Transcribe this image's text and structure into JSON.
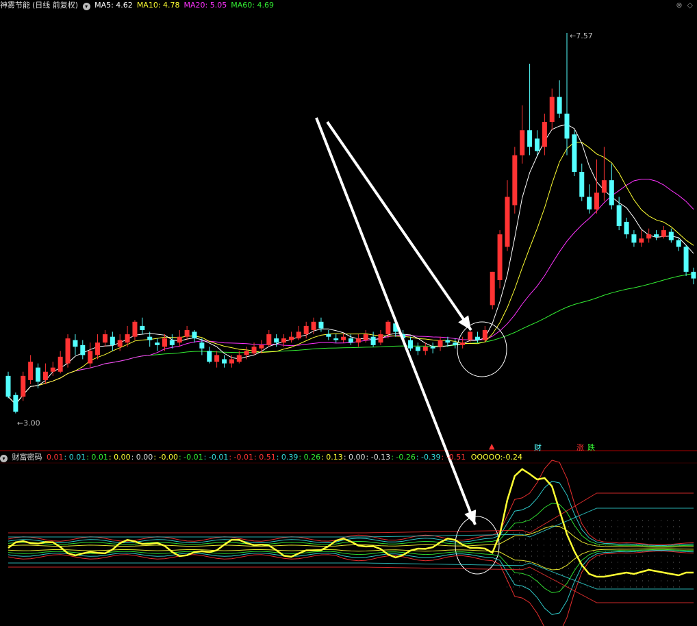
{
  "stock": {
    "name": "神雾节能",
    "period": "(日线 前复权)"
  },
  "ma_header": [
    {
      "label": "MA5: 4.62",
      "color": "#ffffff"
    },
    {
      "label": "MA10: 4.78",
      "color": "#ffff33"
    },
    {
      "label": "MA20: 5.05",
      "color": "#ff33ff"
    },
    {
      "label": "MA60: 4.69",
      "color": "#33ee33"
    }
  ],
  "indicator": {
    "name": "财富密码",
    "values": [
      {
        "t": "0.01",
        "c": "#ff3333"
      },
      {
        "t": ": 0.01",
        "c": "#33dddd"
      },
      {
        "t": ": 0.01",
        "c": "#33ee33"
      },
      {
        "t": ": 0.00",
        "c": "#ffff33"
      },
      {
        "t": ": 0.00",
        "c": "#dddddd"
      },
      {
        "t": ": -0.00",
        "c": "#ffff33"
      },
      {
        "t": ": -0.01",
        "c": "#33ee33"
      },
      {
        "t": ": -0.01",
        "c": "#33dddd"
      },
      {
        "t": ": -0.01",
        "c": "#ff3333"
      },
      {
        "t": ": 0.51",
        "c": "#ff3333"
      },
      {
        "t": ": 0.39",
        "c": "#33dddd"
      },
      {
        "t": ": 0.26",
        "c": "#33ee33"
      },
      {
        "t": ": 0.13",
        "c": "#ffff33"
      },
      {
        "t": ": 0.00",
        "c": "#dddddd"
      },
      {
        "t": ": -0.13",
        "c": "#dddddd"
      },
      {
        "t": ": -0.26",
        "c": "#33ee33"
      },
      {
        "t": ": -0.39",
        "c": "#33dddd"
      },
      {
        "t": ": -0.51",
        "c": "#ff3333"
      }
    ],
    "main": {
      "label": "OOOOO:",
      "value": "-0.24"
    }
  },
  "markers": {
    "cai": "财",
    "zhang": "涨",
    "die": "跌"
  },
  "colors": {
    "up": "#ff3333",
    "down": "#54ffff",
    "ma5": "#ffffff",
    "ma10": "#ffff33",
    "ma20": "#ff33ff",
    "ma60": "#33ee33",
    "border": "#aa0000"
  },
  "chart_data": [
    {
      "type": "candlestick",
      "title": "神雾节能 (日线 前复权)",
      "high_label": "7.57",
      "low_label": "3.00",
      "ylim": [
        2.7,
        7.8
      ],
      "candles": [
        [
          3.45,
          3.2,
          3.5,
          3.18
        ],
        [
          3.22,
          3.02,
          3.25,
          3.0
        ],
        [
          3.2,
          3.45,
          3.5,
          3.15
        ],
        [
          3.4,
          3.62,
          3.7,
          3.35
        ],
        [
          3.55,
          3.38,
          3.6,
          3.3
        ],
        [
          3.4,
          3.5,
          3.6,
          3.35
        ],
        [
          3.5,
          3.55,
          3.62,
          3.45
        ],
        [
          3.5,
          3.68,
          3.75,
          3.48
        ],
        [
          3.6,
          3.9,
          3.95,
          3.55
        ],
        [
          3.88,
          3.8,
          3.95,
          3.7
        ],
        [
          3.82,
          3.7,
          3.88,
          3.65
        ],
        [
          3.6,
          3.75,
          3.85,
          3.55
        ],
        [
          3.7,
          3.85,
          3.95,
          3.65
        ],
        [
          3.85,
          3.95,
          4.0,
          3.8
        ],
        [
          3.92,
          3.82,
          3.98,
          3.75
        ],
        [
          3.8,
          3.88,
          3.95,
          3.75
        ],
        [
          3.85,
          3.95,
          4.05,
          3.8
        ],
        [
          3.92,
          4.1,
          4.12,
          3.88
        ],
        [
          4.05,
          4.0,
          4.15,
          3.95
        ],
        [
          3.92,
          3.88,
          3.98,
          3.8
        ],
        [
          3.85,
          3.82,
          3.9,
          3.75
        ],
        [
          3.8,
          3.9,
          3.95,
          3.75
        ],
        [
          3.88,
          3.82,
          3.95,
          3.78
        ],
        [
          3.85,
          3.92,
          4.0,
          3.8
        ],
        [
          3.92,
          4.0,
          4.05,
          3.88
        ],
        [
          3.98,
          3.9,
          4.0,
          3.85
        ],
        [
          3.85,
          3.78,
          3.9,
          3.7
        ],
        [
          3.75,
          3.62,
          3.8,
          3.6
        ],
        [
          3.62,
          3.7,
          3.75,
          3.55
        ],
        [
          3.65,
          3.6,
          3.7,
          3.55
        ],
        [
          3.6,
          3.65,
          3.7,
          3.55
        ],
        [
          3.62,
          3.7,
          3.75,
          3.6
        ],
        [
          3.7,
          3.75,
          3.8,
          3.65
        ],
        [
          3.72,
          3.8,
          3.85,
          3.7
        ],
        [
          3.78,
          3.82,
          3.88,
          3.72
        ],
        [
          3.82,
          3.95,
          4.0,
          3.8
        ],
        [
          3.9,
          3.85,
          3.95,
          3.8
        ],
        [
          3.85,
          3.9,
          3.95,
          3.8
        ],
        [
          3.88,
          3.92,
          3.98,
          3.85
        ],
        [
          3.9,
          3.98,
          4.05,
          3.88
        ],
        [
          3.95,
          4.05,
          4.1,
          3.9
        ],
        [
          4.0,
          4.1,
          4.15,
          3.95
        ],
        [
          4.1,
          4.02,
          4.15,
          3.98
        ],
        [
          3.95,
          3.92,
          4.0,
          3.88
        ],
        [
          3.9,
          3.88,
          3.95,
          3.85
        ],
        [
          3.88,
          3.92,
          3.96,
          3.85
        ],
        [
          3.9,
          3.85,
          3.95,
          3.82
        ],
        [
          3.85,
          3.9,
          3.95,
          3.8
        ],
        [
          3.88,
          3.95,
          4.0,
          3.85
        ],
        [
          3.92,
          3.82,
          3.98,
          3.8
        ],
        [
          3.85,
          3.95,
          4.0,
          3.82
        ],
        [
          3.95,
          4.1,
          4.12,
          3.9
        ],
        [
          4.08,
          3.98,
          4.12,
          3.92
        ],
        [
          3.95,
          3.9,
          4.0,
          3.85
        ],
        [
          3.88,
          3.78,
          3.92,
          3.75
        ],
        [
          3.8,
          3.75,
          3.85,
          3.7
        ],
        [
          3.75,
          3.8,
          3.85,
          3.7
        ],
        [
          3.8,
          3.78,
          3.85,
          3.72
        ],
        [
          3.8,
          3.88,
          3.92,
          3.75
        ],
        [
          3.88,
          3.85,
          3.92,
          3.8
        ],
        [
          3.85,
          3.82,
          3.9,
          3.78
        ],
        [
          3.82,
          3.85,
          3.92,
          3.78
        ],
        [
          3.88,
          3.98,
          4.02,
          3.85
        ],
        [
          3.92,
          3.88,
          3.98,
          3.85
        ],
        [
          3.88,
          4.0,
          4.05,
          3.85
        ],
        [
          4.3,
          4.7,
          4.7,
          4.25
        ],
        [
          4.6,
          5.15,
          5.2,
          4.5
        ],
        [
          5.0,
          5.6,
          5.8,
          4.95
        ],
        [
          5.5,
          6.1,
          6.2,
          5.4
        ],
        [
          6.1,
          6.4,
          6.7,
          6.0
        ],
        [
          6.4,
          6.2,
          7.2,
          6.1
        ],
        [
          6.3,
          6.15,
          6.4,
          6.1
        ],
        [
          6.2,
          6.5,
          6.6,
          6.1
        ],
        [
          6.5,
          6.8,
          6.9,
          6.4
        ],
        [
          6.8,
          6.6,
          7.0,
          6.55
        ],
        [
          6.6,
          6.3,
          7.57,
          6.1
        ],
        [
          6.35,
          5.9,
          6.4,
          5.85
        ],
        [
          5.9,
          5.6,
          6.0,
          5.55
        ],
        [
          5.6,
          5.45,
          5.75,
          5.4
        ],
        [
          5.45,
          5.65,
          6.05,
          5.4
        ],
        [
          5.65,
          5.8,
          6.2,
          5.55
        ],
        [
          5.8,
          5.5,
          6.0,
          5.45
        ],
        [
          5.5,
          5.25,
          5.6,
          5.2
        ],
        [
          5.3,
          5.15,
          5.35,
          5.1
        ],
        [
          5.15,
          5.05,
          5.2,
          5.0
        ],
        [
          5.05,
          5.1,
          5.2,
          5.0
        ],
        [
          5.1,
          5.15,
          5.22,
          5.05
        ],
        [
          5.15,
          5.12,
          5.2,
          5.08
        ],
        [
          5.12,
          5.2,
          5.25,
          5.1
        ],
        [
          5.18,
          5.08,
          5.22,
          5.05
        ],
        [
          5.08,
          5.0,
          5.1,
          4.95
        ],
        [
          5.0,
          4.7,
          5.02,
          4.65
        ],
        [
          4.7,
          4.62,
          4.75,
          4.55
        ]
      ],
      "series": [
        {
          "name": "MA5"
        },
        {
          "name": "MA10"
        },
        {
          "name": "MA20"
        },
        {
          "name": "MA60"
        }
      ]
    },
    {
      "type": "line",
      "title": "财富密码",
      "band_upper": [
        0.01,
        0.51
      ],
      "band_lower": [
        -0.01,
        -0.51
      ],
      "series": [
        {
          "name": "OOOOO",
          "last": -0.24
        }
      ]
    }
  ]
}
